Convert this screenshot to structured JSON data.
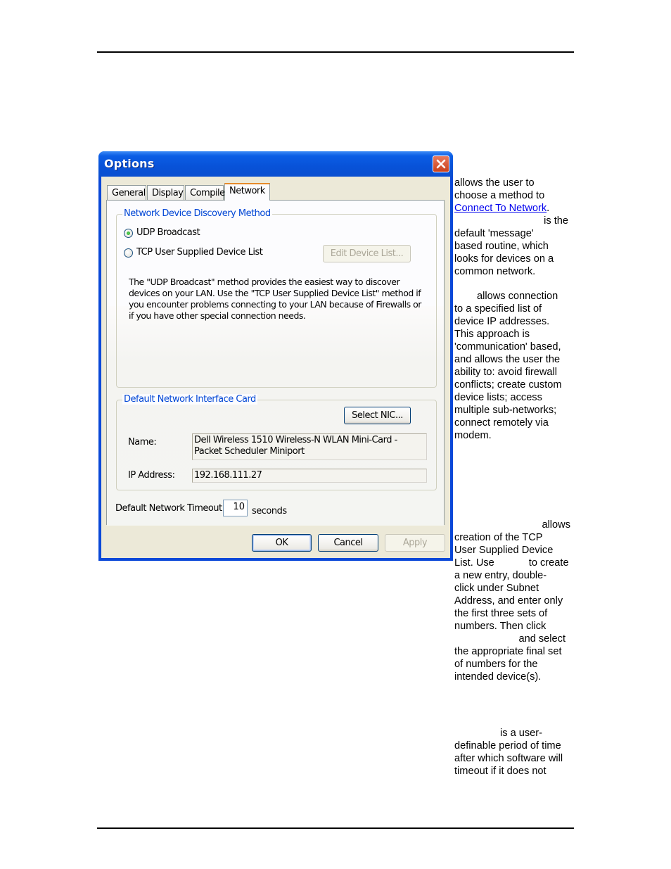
{
  "page": {
    "side_text": {
      "p1": {
        "l1": "allows the user to",
        "l2": "choose a method to",
        "link": "Connect To Network",
        "after_link": ".",
        "l4": "is the",
        "l5": "default 'message'",
        "l6": "based routine, which",
        "l7": "looks for devices on a",
        "l8": "common network."
      },
      "p2": {
        "l1": "allows connection",
        "l2": "to a specified list of",
        "l3": "device IP addresses.",
        "l4": "This approach is",
        "l5": "'communication' based,",
        "l6": "and allows the user the",
        "l7": "ability to: avoid firewall",
        "l8": "conflicts; create custom",
        "l9": "device lists; access",
        "l10": "multiple sub-networks;",
        "l11": "connect remotely via",
        "l12": "modem."
      },
      "p3": {
        "l1": "allows",
        "l2": "creation of the TCP",
        "l3": "User Supplied Device",
        "l4a": "List. Use",
        "l4b": "to create",
        "l5": "a new entry, double-",
        "l6": "click under Subnet",
        "l7": "Address, and enter only",
        "l8": "the first three sets of",
        "l9": "numbers. Then click",
        "l10": "and select",
        "l11": "the appropriate final set",
        "l12": "of numbers for the",
        "l13": "intended device(s)."
      },
      "p4": {
        "l1": "is a user-",
        "l2": "definable period of time",
        "l3": "after which software will",
        "l4": "timeout if it does not"
      }
    }
  },
  "dialog": {
    "title": "Options",
    "tabs": [
      {
        "label": "General",
        "active": false
      },
      {
        "label": "Display",
        "active": false
      },
      {
        "label": "Compile",
        "active": false
      },
      {
        "label": "Network",
        "active": true
      }
    ],
    "discovery": {
      "legend": "Network Device Discovery Method",
      "options": [
        {
          "label": "UDP Broadcast",
          "selected": true
        },
        {
          "label": "TCP User Supplied Device List",
          "selected": false
        }
      ],
      "edit_button": "Edit Device List...",
      "description": "The \"UDP Broadcast\" method provides the easiest way to discover devices on your LAN.  Use the \"TCP User Supplied Device List\" method if you encounter problems connecting to your LAN because of Firewalls or if you have other special connection needs."
    },
    "nic": {
      "legend": "Default Network Interface Card",
      "select_button": "Select NIC...",
      "name_label": "Name:",
      "name_value": "Dell Wireless 1510 Wireless-N WLAN Mini-Card - Packet Scheduler Miniport",
      "ip_label": "IP Address:",
      "ip_value": "192.168.111.27"
    },
    "timeout": {
      "label": "Default Network Timeout:",
      "value": "10",
      "unit": "seconds"
    },
    "buttons": {
      "ok": "OK",
      "cancel": "Cancel",
      "apply": "Apply"
    }
  }
}
